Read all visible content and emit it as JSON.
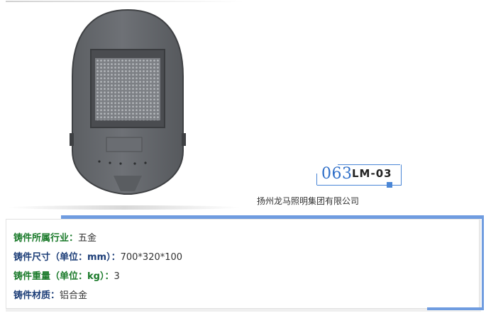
{
  "product": {
    "image_alt": "cast aluminum street light housing",
    "model_number": "063",
    "model_name": "LM-03",
    "company": "扬州龙马照明集团有限公司"
  },
  "specs": [
    {
      "label": "铸件所属行业",
      "colon": "：",
      "value": "五金",
      "color": "#1a7a2a"
    },
    {
      "label": "铸件尺寸（单位：mm）",
      "colon": "：",
      "value": "700*320*100",
      "color": "#1d3e78"
    },
    {
      "label": "铸件重量（单位：kg）",
      "colon": "：",
      "value": "3",
      "color": "#1a7a2a"
    },
    {
      "label": "铸件材质",
      "colon": "：",
      "value": "铝合金",
      "color": "#1d3e78"
    }
  ],
  "colors": {
    "accent": "#6f9ce0",
    "model_blue": "#2f6fc8"
  }
}
